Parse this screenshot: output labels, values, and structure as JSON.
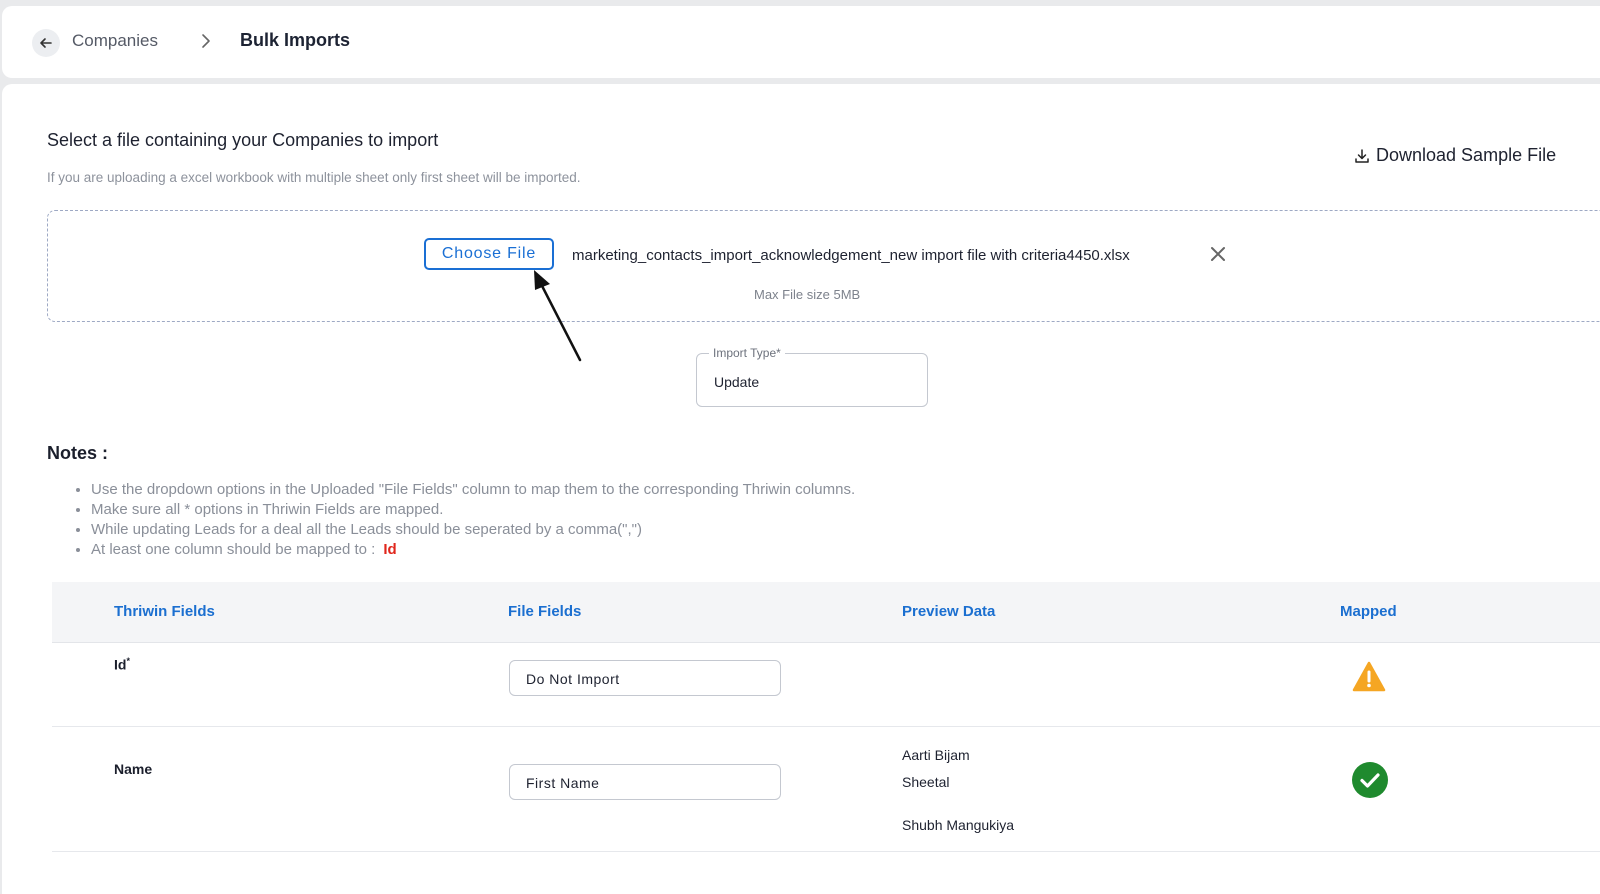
{
  "breadcrumb": {
    "parent": "Companies",
    "current": "Bulk Imports"
  },
  "upload": {
    "title": "Select a file containing your Companies to import",
    "subtitle": "If you are uploading a excel workbook with multiple sheet only first sheet will be imported.",
    "download_label": "Download Sample File",
    "choose_file_label": "Choose File",
    "file_name": "marketing_contacts_import_acknowledgement_new import file with criteria4450.xlsx",
    "max_size": "Max File size 5MB"
  },
  "import_type": {
    "label": "Import Type*",
    "value": "Update"
  },
  "notes": {
    "title": "Notes :",
    "items": [
      "Use the dropdown options in the Uploaded \"File Fields\" column to map them to the corresponding Thriwin columns.",
      "Make sure all * options in Thriwin Fields are mapped.",
      "While updating Leads for a deal all the Leads should be seperated by a comma(\",\")",
      "At least one column should be mapped to :"
    ],
    "required_field": "Id"
  },
  "table": {
    "headers": [
      "Thriwin Fields",
      "File Fields",
      "Preview Data",
      "Mapped"
    ],
    "rows": [
      {
        "field": "Id",
        "required_mark": "*",
        "file_field": "Do Not Import",
        "preview": [],
        "mapped": "warning-icon"
      },
      {
        "field": "Name",
        "required_mark": "",
        "file_field": "First Name",
        "preview": [
          "Aarti Bijam",
          "Sheetal",
          "Shubh Mangukiya"
        ],
        "mapped": "check-icon"
      }
    ]
  },
  "colors": {
    "accent": "#1a6fd4",
    "warning": "#f5a623",
    "success": "#1f8a2e",
    "required": "#e0261c"
  }
}
